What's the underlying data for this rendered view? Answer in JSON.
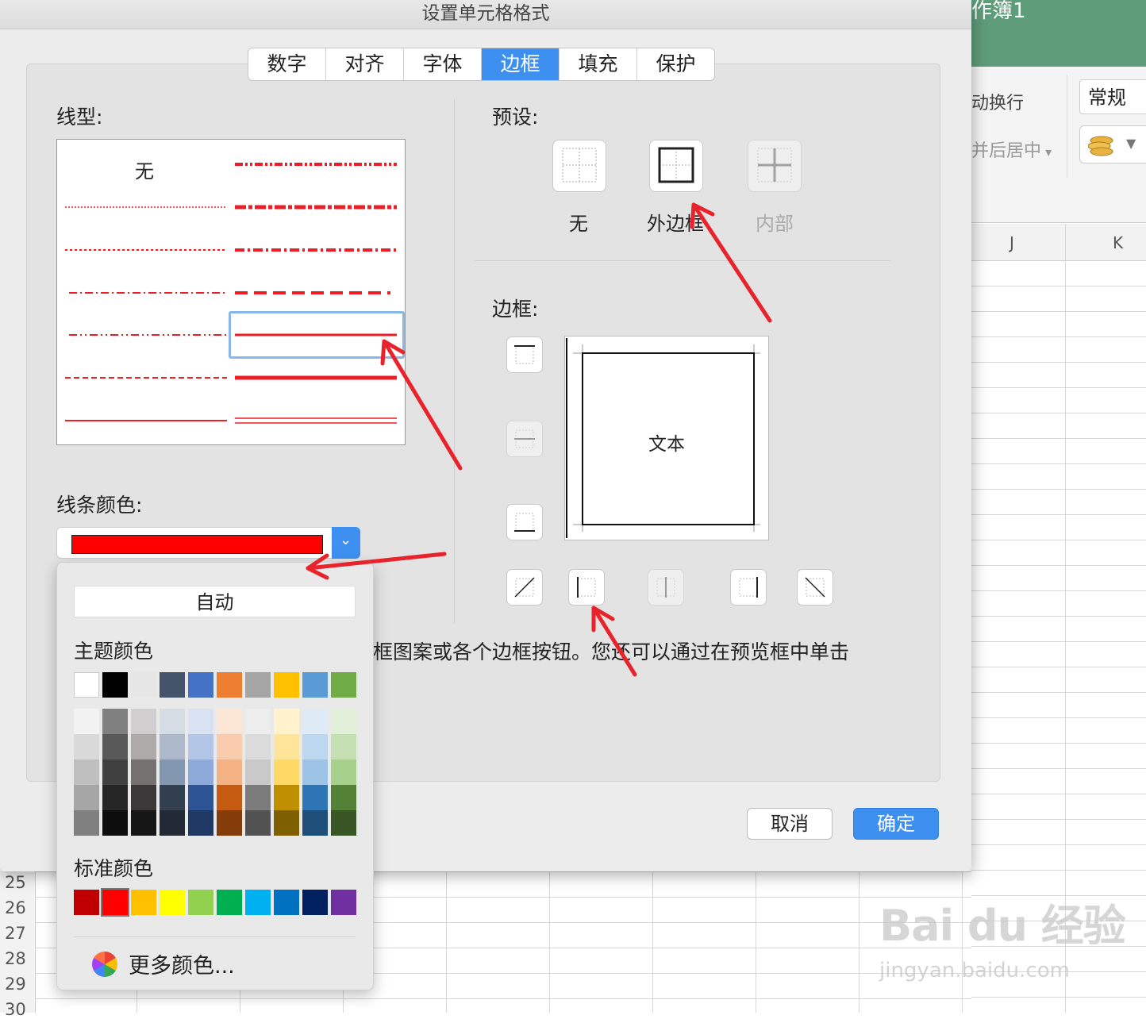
{
  "excel": {
    "title": "作簿1",
    "wrap_text": "动换行",
    "merge_center": "并后居中",
    "number_format": "常规",
    "columns": [
      "J",
      "K"
    ],
    "rows": [
      "25",
      "26",
      "27",
      "28",
      "29",
      "30"
    ]
  },
  "dialog": {
    "title": "设置单元格格式",
    "tabs": [
      "数字",
      "对齐",
      "字体",
      "边框",
      "填充",
      "保护"
    ],
    "active_tab": "边框",
    "line_style_label": "线型:",
    "line_style_none": "无",
    "line_color_label": "线条颜色:",
    "selected_color": "#ff0000",
    "presets_label": "预设:",
    "presets": [
      "无",
      "外边框",
      "内部"
    ],
    "border_label": "边框:",
    "preview_text": "文本",
    "help_text": "框图案或各个边框按钮。您还可以通过在预览框中单击",
    "cancel_label": "取消",
    "ok_label": "确定",
    "accent_color": "#3d8ff0"
  },
  "color_popup": {
    "auto_label": "自动",
    "theme_label": "主题颜色",
    "standard_label": "标准颜色",
    "more_colors_label": "更多颜色...",
    "theme_top": [
      "#ffffff",
      "#000000",
      "#e7e6e6",
      "#44546a",
      "#4472c4",
      "#ed7d31",
      "#a5a5a5",
      "#ffc000",
      "#5b9bd5",
      "#70ad47"
    ],
    "theme_shades": [
      [
        "#f2f2f2",
        "#d9d9d9",
        "#bfbfbf",
        "#a6a6a6",
        "#808080"
      ],
      [
        "#808080",
        "#595959",
        "#404040",
        "#262626",
        "#0d0d0d"
      ],
      [
        "#d0cece",
        "#aeaaaa",
        "#757171",
        "#3a3838",
        "#171616"
      ],
      [
        "#d6dce4",
        "#adb9ca",
        "#8497b0",
        "#323f4f",
        "#222a35"
      ],
      [
        "#d9e2f3",
        "#b4c6e7",
        "#8eaadb",
        "#2f5496",
        "#1f3864"
      ],
      [
        "#fbe5d5",
        "#f7cbac",
        "#f4b183",
        "#c55a11",
        "#843c0b"
      ],
      [
        "#ededed",
        "#dbdbdb",
        "#c9c9c9",
        "#7b7b7b",
        "#525252"
      ],
      [
        "#fff2cc",
        "#fee599",
        "#ffd965",
        "#bf8f00",
        "#7f6000"
      ],
      [
        "#deebf6",
        "#bdd7ee",
        "#9dc3e6",
        "#2e75b5",
        "#1f4e79"
      ],
      [
        "#e2efd9",
        "#c5e0b3",
        "#a8d08d",
        "#538135",
        "#375623"
      ]
    ],
    "standard": [
      "#c00000",
      "#ff0000",
      "#ffc000",
      "#ffff00",
      "#92d050",
      "#00b050",
      "#00b0f0",
      "#0070c0",
      "#002060",
      "#7030a0"
    ],
    "standard_selected_index": 1
  },
  "watermark": {
    "brand": "Bai du 经验",
    "url": "jingyan.baidu.com"
  }
}
